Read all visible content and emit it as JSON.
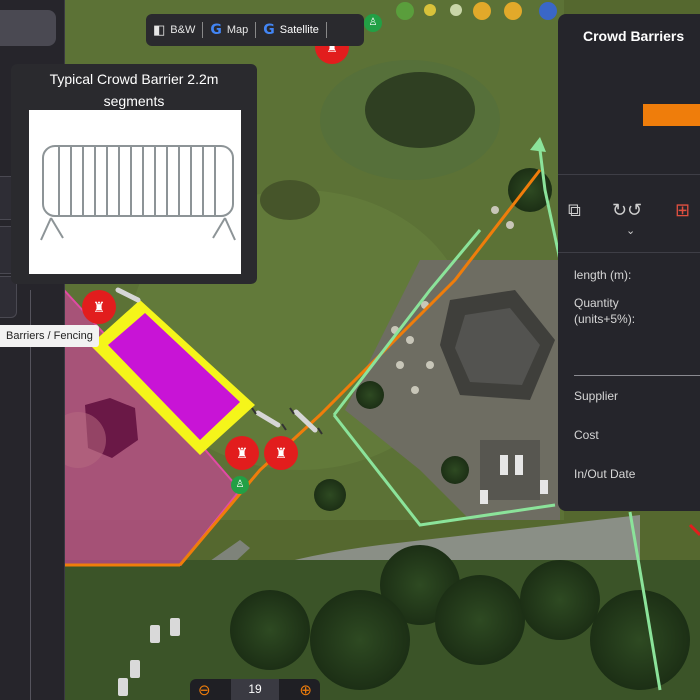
{
  "map_type_bar": {
    "bw_label": "B&W",
    "map_label": "Map",
    "satellite_label": "Satellite"
  },
  "popup": {
    "title": "Typical Crowd Barrier 2.2m segments"
  },
  "tooltip": {
    "text": "Barriers / Fencing"
  },
  "right_panel": {
    "title": "Crowd Barriers",
    "length_label": "length (m):",
    "quantity_label": "Quantity (units+5%):",
    "supplier_label": "Supplier",
    "cost_label": "Cost",
    "inout_label": "In/Out Date"
  },
  "zoom": {
    "level": "19"
  },
  "colors": {
    "accent": "#ef7d0b",
    "marker_red": "#e21d1d",
    "fence_green": "#8be39a",
    "zone_purple": "#c814d6",
    "zone_yellow": "#f5f51a",
    "pink_zone": "#d6459a"
  },
  "icons": {
    "bw": "bw-map-icon",
    "google": "google-g-icon",
    "copy": "copy-icon",
    "rotate": "rotate-icon",
    "grid": "grid-select-icon",
    "zoom_out": "zoom-out-icon",
    "zoom_in": "zoom-in-icon",
    "barrier_marker": "barrier-marker-icon",
    "person_marker": "person-marker-icon"
  }
}
